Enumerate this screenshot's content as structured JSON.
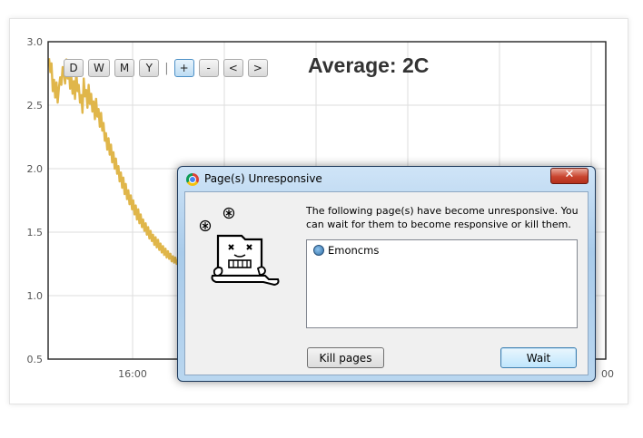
{
  "chart_data": {
    "type": "line",
    "title": "",
    "xlabel": "",
    "ylabel": "",
    "ylim": [
      0.5,
      3.0
    ],
    "y_ticks": [
      "3.0",
      "2.5",
      "2.0",
      "1.5",
      "1.0",
      "0.5"
    ],
    "x_ticks": [
      "16:00",
      "00"
    ],
    "grid": true,
    "series": [
      {
        "color": "#e0b64a",
        "x": [
          0,
          0.01,
          0.02,
          0.03,
          0.04,
          0.05,
          0.06,
          0.07,
          0.08,
          0.09,
          0.1,
          0.11,
          0.12,
          0.13,
          0.14,
          0.15,
          0.16,
          0.17,
          0.18,
          0.19,
          0.2,
          0.21,
          0.22,
          0.23,
          0.24,
          0.25,
          0.26,
          0.27,
          0.28,
          0.29,
          0.3,
          0.31,
          0.32,
          0.33,
          0.34,
          0.35,
          0.36,
          0.37,
          0.38,
          0.39,
          0.4,
          0.41,
          0.42,
          0.43,
          0.44,
          0.45,
          0.46,
          0.47,
          0.48,
          0.49,
          0.5,
          0.51,
          0.52,
          0.53,
          0.54,
          0.55,
          0.56,
          0.57,
          0.58,
          0.59,
          0.6,
          0.61,
          0.62,
          0.63,
          0.64,
          0.65,
          0.66,
          0.67,
          0.68,
          0.69,
          0.7,
          0.71,
          0.72,
          0.73,
          0.74,
          0.75,
          0.76,
          0.77,
          0.78,
          0.79,
          0.8,
          0.81,
          0.82,
          0.83,
          0.84,
          0.85,
          0.86,
          0.87,
          0.88,
          0.89,
          0.9,
          0.91,
          0.92,
          0.93,
          0.94,
          0.95,
          0.96,
          0.97,
          0.98,
          0.99,
          1.0,
          1.01,
          1.02,
          1.03,
          1.04,
          1.05,
          1.06,
          1.07,
          1.08,
          1.09,
          1.1
        ],
        "values": [
          2.87,
          2.76,
          2.83,
          2.61,
          2.7,
          2.56,
          2.68,
          2.52,
          2.64,
          2.72,
          2.66,
          2.8,
          2.74,
          2.67,
          2.86,
          2.71,
          2.79,
          2.63,
          2.73,
          2.59,
          2.69,
          2.55,
          2.77,
          2.61,
          2.66,
          2.52,
          2.58,
          2.44,
          2.71,
          2.57,
          2.62,
          2.48,
          2.66,
          2.51,
          2.59,
          2.45,
          2.53,
          2.39,
          2.55,
          2.41,
          2.47,
          2.33,
          2.44,
          2.3,
          2.36,
          2.22,
          2.28,
          2.15,
          2.24,
          2.11,
          2.19,
          2.05,
          2.13,
          2.0,
          2.08,
          1.96,
          2.02,
          1.9,
          1.97,
          1.85,
          1.93,
          1.8,
          1.88,
          1.76,
          1.83,
          1.72,
          1.79,
          1.68,
          1.75,
          1.64,
          1.71,
          1.6,
          1.68,
          1.57,
          1.64,
          1.54,
          1.6,
          1.51,
          1.57,
          1.48,
          1.54,
          1.45,
          1.51,
          1.43,
          1.48,
          1.4,
          1.46,
          1.38,
          1.44,
          1.36,
          1.41,
          1.34,
          1.39,
          1.32,
          1.37,
          1.3,
          1.35,
          1.29,
          1.33,
          1.27,
          1.31,
          1.26,
          1.3,
          1.25,
          1.28,
          1.24,
          1.27,
          1.23,
          1.26,
          1.22,
          1.25
        ]
      }
    ]
  },
  "toolbar": {
    "buttons": [
      "D",
      "W",
      "M",
      "Y",
      "+",
      "-",
      "<",
      ">"
    ],
    "separator": "|"
  },
  "average": "Average: 2C",
  "dialog": {
    "title": "Page(s) Unresponsive",
    "close_glyph": "✕",
    "message": "The following page(s) have become unresponsive. You can wait for them to become responsive or kill them.",
    "pages": [
      "Emoncms"
    ],
    "kill_label": "Kill pages",
    "wait_label": "Wait"
  }
}
